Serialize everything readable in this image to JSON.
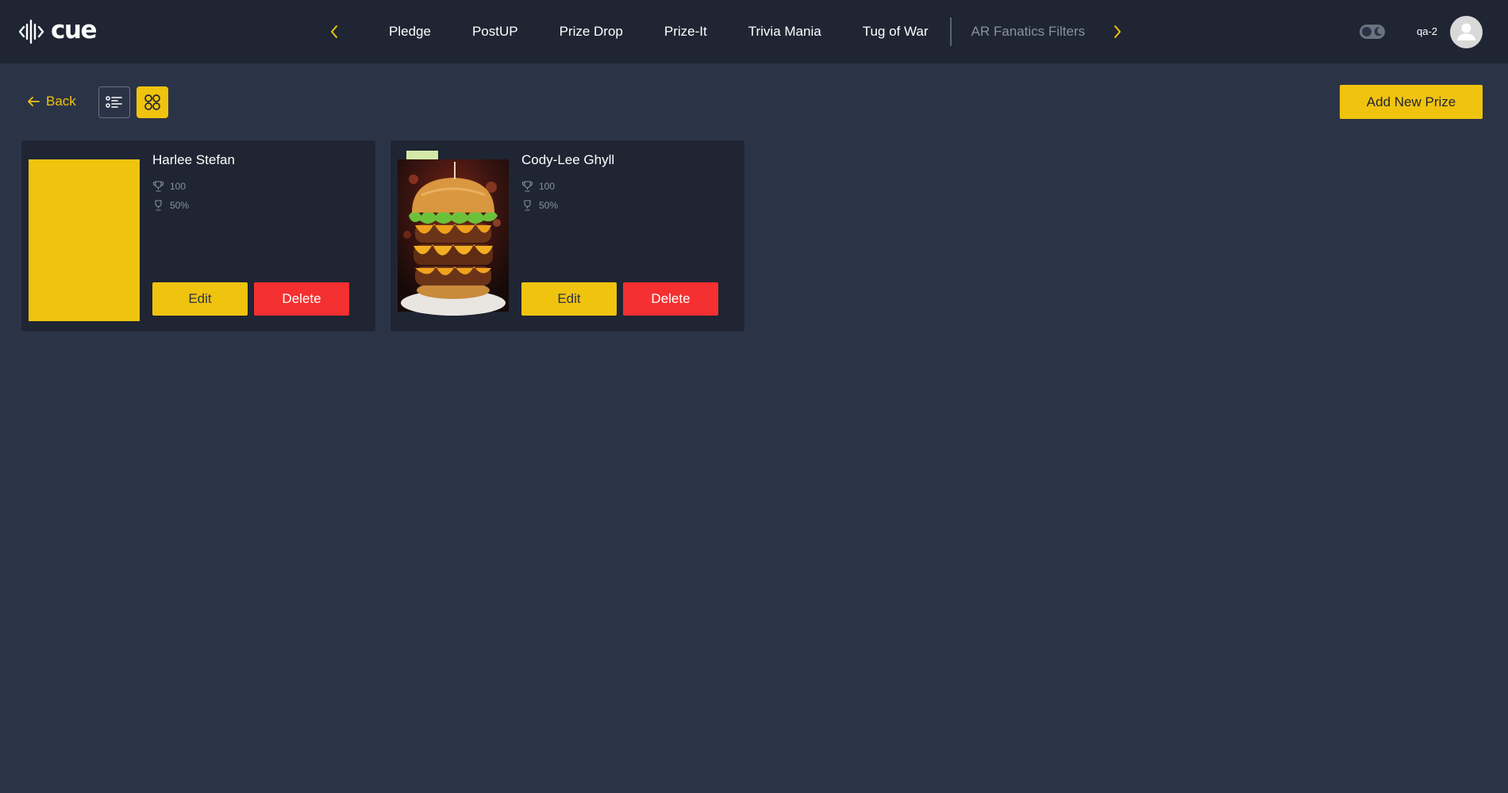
{
  "brand": {
    "name": "cue"
  },
  "nav": {
    "items": [
      "Pledge",
      "PostUP",
      "Prize Drop",
      "Prize-It",
      "Trivia Mania",
      "Tug of War"
    ],
    "secondary": "AR Fanatics Filters"
  },
  "user": {
    "name": "qa-2"
  },
  "toolbar": {
    "back_label": "Back",
    "add_label": "Add New Prize"
  },
  "prizes": [
    {
      "name": "Harlee Stefan",
      "quantity": "100",
      "odds": "50%",
      "edit_label": "Edit",
      "delete_label": "Delete",
      "image": "yellow-placeholder"
    },
    {
      "name": "Cody-Lee Ghyll",
      "quantity": "100",
      "odds": "50%",
      "edit_label": "Edit",
      "delete_label": "Delete",
      "image": "stacked-burger-photo"
    }
  ],
  "colors": {
    "accent": "#f0c30f",
    "danger": "#f43030",
    "background": "#2b3447",
    "surface": "#1f2533"
  }
}
